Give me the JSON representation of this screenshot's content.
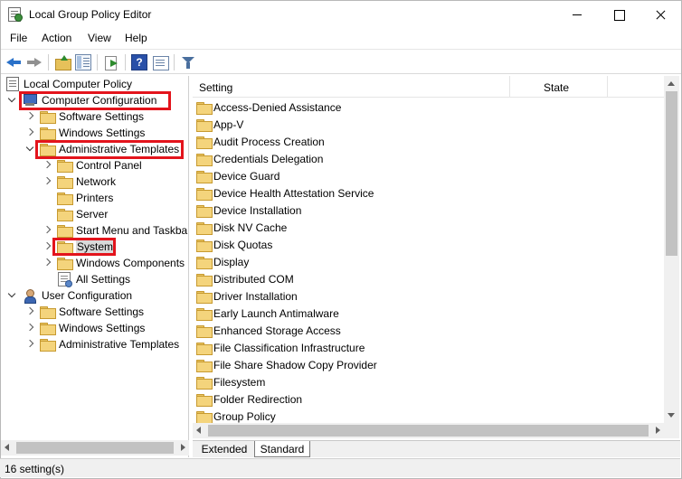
{
  "window": {
    "title": "Local Group Policy Editor"
  },
  "menu": [
    "File",
    "Action",
    "View",
    "Help"
  ],
  "toolbar": {
    "help_label": "?"
  },
  "tree": {
    "root": "Local Computer Policy",
    "computer_config": "Computer Configuration",
    "cc_software": "Software Settings",
    "cc_windows": "Windows Settings",
    "cc_admin": "Administrative Templates",
    "admin_children": [
      "Control Panel",
      "Network",
      "Printers",
      "Server",
      "Start Menu and Taskbar",
      "System",
      "Windows Components",
      "All Settings"
    ],
    "user_config": "User Configuration",
    "uc_software": "Software Settings",
    "uc_windows": "Windows Settings",
    "uc_admin": "Administrative Templates"
  },
  "list": {
    "columns": [
      "Setting",
      "State"
    ],
    "rows": [
      "Access-Denied Assistance",
      "App-V",
      "Audit Process Creation",
      "Credentials Delegation",
      "Device Guard",
      "Device Health Attestation Service",
      "Device Installation",
      "Disk NV Cache",
      "Disk Quotas",
      "Display",
      "Distributed COM",
      "Driver Installation",
      "Early Launch Antimalware",
      "Enhanced Storage Access",
      "File Classification Infrastructure",
      "File Share Shadow Copy Provider",
      "Filesystem",
      "Folder Redirection",
      "Group Policy"
    ]
  },
  "tabs": [
    "Extended",
    "Standard"
  ],
  "status": "16 setting(s)",
  "colors": {
    "highlight_box": "#e3141c"
  }
}
